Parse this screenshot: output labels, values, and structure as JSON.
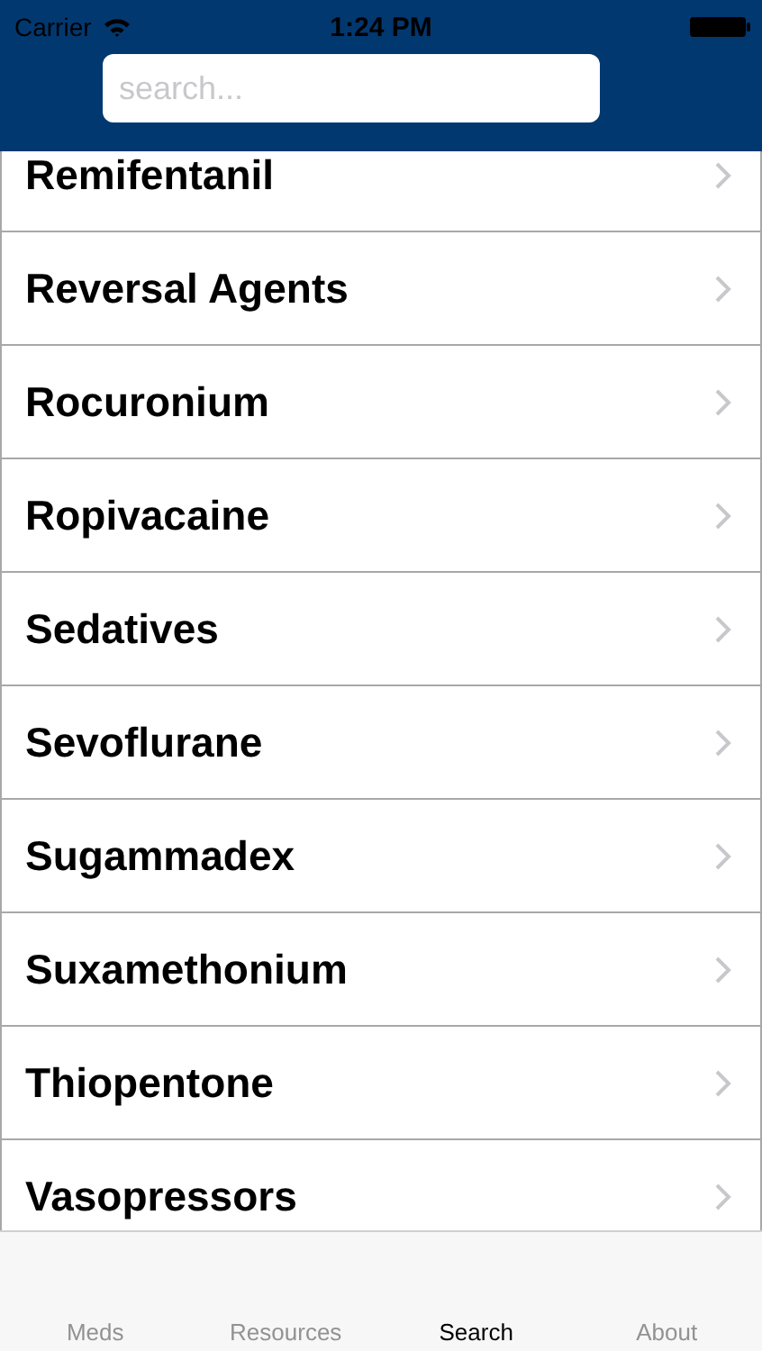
{
  "status_bar": {
    "carrier": "Carrier",
    "time": "1:24 PM"
  },
  "search": {
    "placeholder": "search..."
  },
  "list": {
    "items": [
      {
        "label": "Remifentanil"
      },
      {
        "label": "Reversal Agents"
      },
      {
        "label": "Rocuronium"
      },
      {
        "label": "Ropivacaine"
      },
      {
        "label": "Sedatives"
      },
      {
        "label": "Sevoflurane"
      },
      {
        "label": "Sugammadex"
      },
      {
        "label": "Suxamethonium"
      },
      {
        "label": "Thiopentone"
      },
      {
        "label": "Vasopressors"
      }
    ]
  },
  "tab_bar": [
    {
      "label": "Meds",
      "selected": false
    },
    {
      "label": "Resources",
      "selected": false
    },
    {
      "label": "Search",
      "selected": true
    },
    {
      "label": "About",
      "selected": false
    }
  ]
}
